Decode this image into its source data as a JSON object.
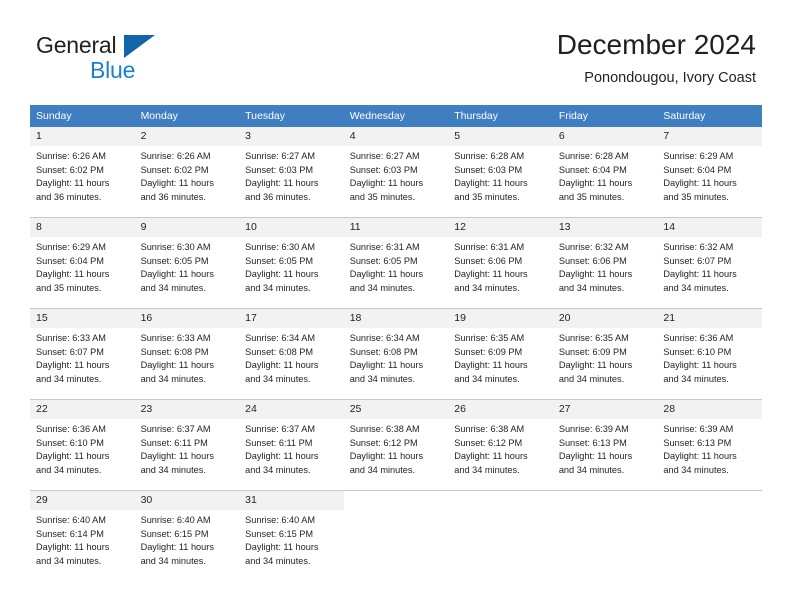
{
  "brand": {
    "word_one": "General",
    "word_two": "Blue",
    "triangle_icon": "triangle-icon",
    "accent_color": "#1464aa",
    "blue_text_color": "#1b7fd4"
  },
  "header": {
    "title": "December 2024",
    "subtitle": "Ponondougou, Ivory Coast"
  },
  "calendar": {
    "header_bg": "#3f7fc1",
    "daynum_bg": "#f2f2f2",
    "grid_line": "#c8c8c8",
    "weekday_headers": [
      "Sunday",
      "Monday",
      "Tuesday",
      "Wednesday",
      "Thursday",
      "Friday",
      "Saturday"
    ],
    "weeks": [
      [
        {
          "day": "1",
          "sunrise": "Sunrise: 6:26 AM",
          "sunset": "Sunset: 6:02 PM",
          "daylight_line1": "Daylight: 11 hours",
          "daylight_line2": "and 36 minutes."
        },
        {
          "day": "2",
          "sunrise": "Sunrise: 6:26 AM",
          "sunset": "Sunset: 6:02 PM",
          "daylight_line1": "Daylight: 11 hours",
          "daylight_line2": "and 36 minutes."
        },
        {
          "day": "3",
          "sunrise": "Sunrise: 6:27 AM",
          "sunset": "Sunset: 6:03 PM",
          "daylight_line1": "Daylight: 11 hours",
          "daylight_line2": "and 36 minutes."
        },
        {
          "day": "4",
          "sunrise": "Sunrise: 6:27 AM",
          "sunset": "Sunset: 6:03 PM",
          "daylight_line1": "Daylight: 11 hours",
          "daylight_line2": "and 35 minutes."
        },
        {
          "day": "5",
          "sunrise": "Sunrise: 6:28 AM",
          "sunset": "Sunset: 6:03 PM",
          "daylight_line1": "Daylight: 11 hours",
          "daylight_line2": "and 35 minutes."
        },
        {
          "day": "6",
          "sunrise": "Sunrise: 6:28 AM",
          "sunset": "Sunset: 6:04 PM",
          "daylight_line1": "Daylight: 11 hours",
          "daylight_line2": "and 35 minutes."
        },
        {
          "day": "7",
          "sunrise": "Sunrise: 6:29 AM",
          "sunset": "Sunset: 6:04 PM",
          "daylight_line1": "Daylight: 11 hours",
          "daylight_line2": "and 35 minutes."
        }
      ],
      [
        {
          "day": "8",
          "sunrise": "Sunrise: 6:29 AM",
          "sunset": "Sunset: 6:04 PM",
          "daylight_line1": "Daylight: 11 hours",
          "daylight_line2": "and 35 minutes."
        },
        {
          "day": "9",
          "sunrise": "Sunrise: 6:30 AM",
          "sunset": "Sunset: 6:05 PM",
          "daylight_line1": "Daylight: 11 hours",
          "daylight_line2": "and 34 minutes."
        },
        {
          "day": "10",
          "sunrise": "Sunrise: 6:30 AM",
          "sunset": "Sunset: 6:05 PM",
          "daylight_line1": "Daylight: 11 hours",
          "daylight_line2": "and 34 minutes."
        },
        {
          "day": "11",
          "sunrise": "Sunrise: 6:31 AM",
          "sunset": "Sunset: 6:05 PM",
          "daylight_line1": "Daylight: 11 hours",
          "daylight_line2": "and 34 minutes."
        },
        {
          "day": "12",
          "sunrise": "Sunrise: 6:31 AM",
          "sunset": "Sunset: 6:06 PM",
          "daylight_line1": "Daylight: 11 hours",
          "daylight_line2": "and 34 minutes."
        },
        {
          "day": "13",
          "sunrise": "Sunrise: 6:32 AM",
          "sunset": "Sunset: 6:06 PM",
          "daylight_line1": "Daylight: 11 hours",
          "daylight_line2": "and 34 minutes."
        },
        {
          "day": "14",
          "sunrise": "Sunrise: 6:32 AM",
          "sunset": "Sunset: 6:07 PM",
          "daylight_line1": "Daylight: 11 hours",
          "daylight_line2": "and 34 minutes."
        }
      ],
      [
        {
          "day": "15",
          "sunrise": "Sunrise: 6:33 AM",
          "sunset": "Sunset: 6:07 PM",
          "daylight_line1": "Daylight: 11 hours",
          "daylight_line2": "and 34 minutes."
        },
        {
          "day": "16",
          "sunrise": "Sunrise: 6:33 AM",
          "sunset": "Sunset: 6:08 PM",
          "daylight_line1": "Daylight: 11 hours",
          "daylight_line2": "and 34 minutes."
        },
        {
          "day": "17",
          "sunrise": "Sunrise: 6:34 AM",
          "sunset": "Sunset: 6:08 PM",
          "daylight_line1": "Daylight: 11 hours",
          "daylight_line2": "and 34 minutes."
        },
        {
          "day": "18",
          "sunrise": "Sunrise: 6:34 AM",
          "sunset": "Sunset: 6:08 PM",
          "daylight_line1": "Daylight: 11 hours",
          "daylight_line2": "and 34 minutes."
        },
        {
          "day": "19",
          "sunrise": "Sunrise: 6:35 AM",
          "sunset": "Sunset: 6:09 PM",
          "daylight_line1": "Daylight: 11 hours",
          "daylight_line2": "and 34 minutes."
        },
        {
          "day": "20",
          "sunrise": "Sunrise: 6:35 AM",
          "sunset": "Sunset: 6:09 PM",
          "daylight_line1": "Daylight: 11 hours",
          "daylight_line2": "and 34 minutes."
        },
        {
          "day": "21",
          "sunrise": "Sunrise: 6:36 AM",
          "sunset": "Sunset: 6:10 PM",
          "daylight_line1": "Daylight: 11 hours",
          "daylight_line2": "and 34 minutes."
        }
      ],
      [
        {
          "day": "22",
          "sunrise": "Sunrise: 6:36 AM",
          "sunset": "Sunset: 6:10 PM",
          "daylight_line1": "Daylight: 11 hours",
          "daylight_line2": "and 34 minutes."
        },
        {
          "day": "23",
          "sunrise": "Sunrise: 6:37 AM",
          "sunset": "Sunset: 6:11 PM",
          "daylight_line1": "Daylight: 11 hours",
          "daylight_line2": "and 34 minutes."
        },
        {
          "day": "24",
          "sunrise": "Sunrise: 6:37 AM",
          "sunset": "Sunset: 6:11 PM",
          "daylight_line1": "Daylight: 11 hours",
          "daylight_line2": "and 34 minutes."
        },
        {
          "day": "25",
          "sunrise": "Sunrise: 6:38 AM",
          "sunset": "Sunset: 6:12 PM",
          "daylight_line1": "Daylight: 11 hours",
          "daylight_line2": "and 34 minutes."
        },
        {
          "day": "26",
          "sunrise": "Sunrise: 6:38 AM",
          "sunset": "Sunset: 6:12 PM",
          "daylight_line1": "Daylight: 11 hours",
          "daylight_line2": "and 34 minutes."
        },
        {
          "day": "27",
          "sunrise": "Sunrise: 6:39 AM",
          "sunset": "Sunset: 6:13 PM",
          "daylight_line1": "Daylight: 11 hours",
          "daylight_line2": "and 34 minutes."
        },
        {
          "day": "28",
          "sunrise": "Sunrise: 6:39 AM",
          "sunset": "Sunset: 6:13 PM",
          "daylight_line1": "Daylight: 11 hours",
          "daylight_line2": "and 34 minutes."
        }
      ],
      [
        {
          "day": "29",
          "sunrise": "Sunrise: 6:40 AM",
          "sunset": "Sunset: 6:14 PM",
          "daylight_line1": "Daylight: 11 hours",
          "daylight_line2": "and 34 minutes."
        },
        {
          "day": "30",
          "sunrise": "Sunrise: 6:40 AM",
          "sunset": "Sunset: 6:15 PM",
          "daylight_line1": "Daylight: 11 hours",
          "daylight_line2": "and 34 minutes."
        },
        {
          "day": "31",
          "sunrise": "Sunrise: 6:40 AM",
          "sunset": "Sunset: 6:15 PM",
          "daylight_line1": "Daylight: 11 hours",
          "daylight_line2": "and 34 minutes."
        },
        {
          "day": "",
          "sunrise": "",
          "sunset": "",
          "daylight_line1": "",
          "daylight_line2": ""
        },
        {
          "day": "",
          "sunrise": "",
          "sunset": "",
          "daylight_line1": "",
          "daylight_line2": ""
        },
        {
          "day": "",
          "sunrise": "",
          "sunset": "",
          "daylight_line1": "",
          "daylight_line2": ""
        },
        {
          "day": "",
          "sunrise": "",
          "sunset": "",
          "daylight_line1": "",
          "daylight_line2": ""
        }
      ]
    ]
  }
}
